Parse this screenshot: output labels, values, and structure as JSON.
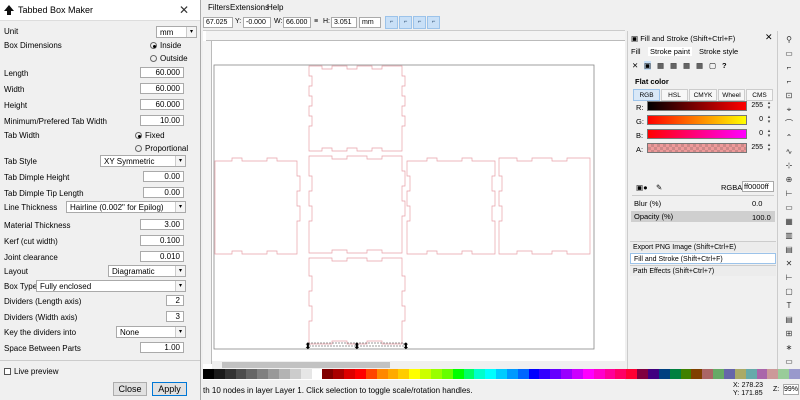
{
  "dialog": {
    "title": "Tabbed Box Maker",
    "unit_label": "Unit",
    "unit_value": "mm",
    "box_dimensions_label": "Box Dimensions",
    "inside_label": "Inside",
    "outside_label": "Outside",
    "length_label": "Length",
    "length_value": "60.000",
    "width_label": "Width",
    "width_value": "60.000",
    "height_label": "Height",
    "height_value": "60.000",
    "min_tab_width_label": "Minimum/Prefered Tab Width",
    "min_tab_width_value": "10.00",
    "tab_width_label": "Tab Width",
    "fixed_label": "Fixed",
    "proportional_label": "Proportional",
    "tab_style_label": "Tab Style",
    "tab_style_value": "XY Symmetric",
    "tab_dimple_height_label": "Tab Dimple Height",
    "tab_dimple_height_value": "0.00",
    "tab_dimple_tip_label": "Tab Dimple Tip Length",
    "tab_dimple_tip_value": "0.00",
    "line_thickness_label": "Line Thickness",
    "line_thickness_value": "Hairline (0.002\" for Epilog)",
    "material_thickness_label": "Material Thickness",
    "material_thickness_value": "3.00",
    "kerf_label": "Kerf (cut width)",
    "kerf_value": "0.100",
    "joint_clearance_label": "Joint clearance",
    "joint_clearance_value": "0.010",
    "layout_label": "Layout",
    "layout_value": "Diagramatic",
    "box_type_label": "Box Type",
    "box_type_value": "Fully enclosed",
    "dividers_length_label": "Dividers (Length axis)",
    "dividers_length_value": "2",
    "dividers_width_label": "Dividers (Width axis)",
    "dividers_width_value": "3",
    "key_dividers_label": "Key the dividers into",
    "key_dividers_value": "None",
    "space_between_label": "Space Between Parts",
    "space_between_value": "1.00",
    "live_preview_label": "Live preview",
    "close_label": "Close",
    "apply_label": "Apply"
  },
  "menu": {
    "filters": "Filters",
    "extensions": "Extensions",
    "help": "Help"
  },
  "toolbar": {
    "x_value": "67.025",
    "y_label": "Y:",
    "y_value": "-0.000",
    "w_label": "W:",
    "w_value": "66.000",
    "h_label": "H:",
    "h_value": "3.051",
    "unit": "mm"
  },
  "panel": {
    "header": "Fill and Stroke (Shift+Ctrl+F)",
    "tab_fill": "Fill",
    "tab_stroke_paint": "Stroke paint",
    "tab_stroke_style": "Stroke style",
    "flat_color": "Flat color",
    "modes": [
      "RGB",
      "HSL",
      "CMYK",
      "Wheel",
      "CMS"
    ],
    "channels": [
      {
        "label": "R:",
        "value": "255"
      },
      {
        "label": "G:",
        "value": "0"
      },
      {
        "label": "B:",
        "value": "0"
      },
      {
        "label": "A:",
        "value": "255"
      }
    ],
    "rgba_label": "RGBA:",
    "rgba_value": "ff0000ff",
    "blur_label": "Blur (%)",
    "blur_value": "0.0",
    "opacity_label": "Opacity (%)",
    "opacity_value": "100.0",
    "sections": [
      "Export PNG Image (Shift+Ctrl+E)",
      "Fill and Stroke (Shift+Ctrl+F)",
      "Path Effects  (Shift+Ctrl+7)"
    ]
  },
  "status": {
    "message": "th 10 nodes in layer Layer 1. Click selection to toggle scale/rotation handles.",
    "x_label": "X:",
    "x_value": "278.23",
    "y_label": "Y:",
    "y_value": "171.85",
    "zoom_label": "Z:",
    "zoom_value": "99%"
  },
  "colors": {
    "accent": "#c9e0f7",
    "cut_line": "#e8a0a8",
    "stroke": "#ff0000"
  }
}
